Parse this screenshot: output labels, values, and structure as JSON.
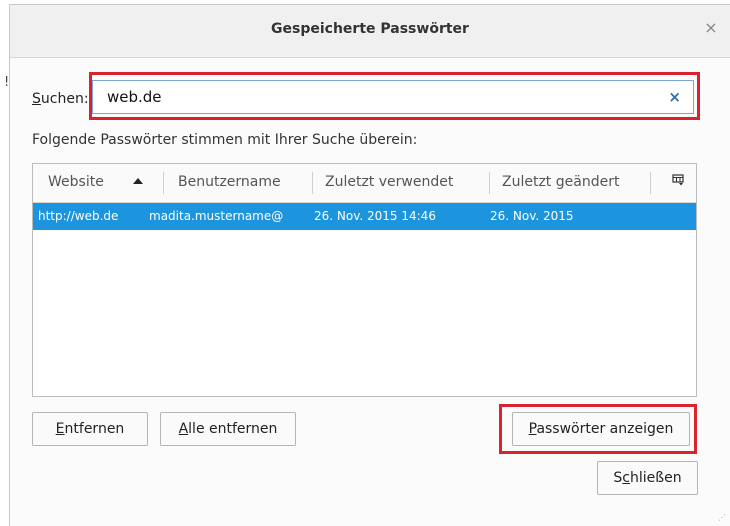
{
  "dialog": {
    "title": "Gespeicherte Passwörter",
    "close_glyph": "×"
  },
  "search": {
    "label_mnemonic": "S",
    "label_rest": "uchen:",
    "value": "web.de",
    "clear_glyph": "×"
  },
  "matches_text": "Folgende Passwörter stimmen mit Ihrer Suche überein:",
  "table": {
    "columns": [
      "Website",
      "Benutzername",
      "Zuletzt verwendet",
      "Zuletzt geändert"
    ],
    "sort_column": "Website",
    "sort_direction": "ascending",
    "rows": [
      {
        "website": "http://web.de",
        "username": "madita.mustername@",
        "last_used": "26. Nov. 2015 14:46",
        "last_changed": "26. Nov. 2015",
        "selected": true
      }
    ],
    "selection_color": "#1c95de"
  },
  "buttons": {
    "remove": {
      "mnemonic": "E",
      "rest": "ntfernen"
    },
    "remove_all": {
      "mnemonic": "A",
      "rest": "lle entfernen"
    },
    "show_passwords": {
      "mnemonic": "P",
      "rest": "asswörter anzeigen"
    },
    "close": {
      "before": "S",
      "mnemonic": "c",
      "rest": "hließen"
    }
  },
  "highlight_color": "#d9232f",
  "icons": {
    "dialog_close": "close-icon",
    "search_clear": "clear-icon",
    "sort": "sort-ascending-icon",
    "column_picker": "column-picker-icon"
  }
}
